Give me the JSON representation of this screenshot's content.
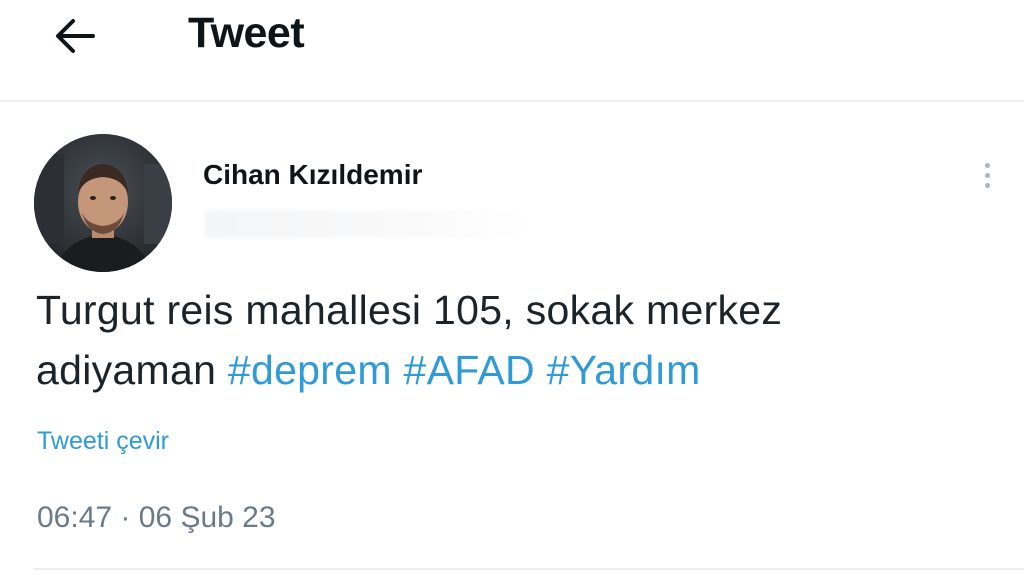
{
  "header": {
    "back_icon": "arrow-left-icon",
    "title": "Tweet"
  },
  "tweet": {
    "author_name": "Cihan Kızıldemir",
    "text_line1": "Turgut reis mahallesi 105, sokak merkez",
    "text_line2_prefix": "adiyaman ",
    "hashtags": [
      "#deprem",
      "#AFAD",
      "#Yardım"
    ],
    "translate_label": "Tweeti çevir",
    "timestamp": "06:47 · 06 Şub 23"
  },
  "colors": {
    "link": "#2f9ad8",
    "text": "#0f1419",
    "muted": "#6b7a87"
  }
}
